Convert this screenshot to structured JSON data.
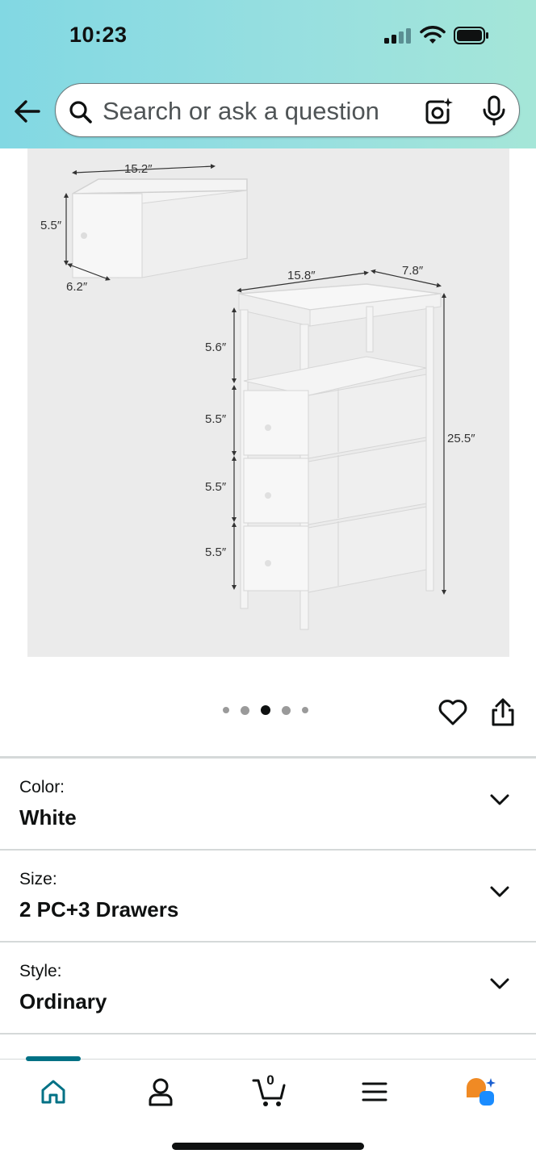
{
  "status_bar": {
    "time": "10:23"
  },
  "search": {
    "placeholder": "Search or ask a question"
  },
  "product_image": {
    "dimensions": {
      "drawer_width": "15.2″",
      "drawer_height": "5.5″",
      "drawer_depth": "6.2″",
      "unit_width": "15.8″",
      "unit_depth": "7.8″",
      "unit_height": "25.5″",
      "shelf_gap": "5.6″",
      "drawer1": "5.5″",
      "drawer2": "5.5″",
      "drawer3": "5.5″"
    },
    "carousel": {
      "total": 5,
      "active_index": 2
    }
  },
  "variants": [
    {
      "label": "Color:",
      "value": "White"
    },
    {
      "label": "Size:",
      "value": "2 PC+3 Drawers"
    },
    {
      "label": "Style:",
      "value": "Ordinary"
    }
  ],
  "cart": {
    "count": "0"
  },
  "icons": {
    "back": "back-arrow-icon",
    "search": "search-icon",
    "camera": "camera-lens-icon",
    "mic": "microphone-icon",
    "heart": "heart-icon",
    "share": "share-icon",
    "chevron": "chevron-down-icon",
    "home": "home-icon",
    "account": "account-icon",
    "cart": "cart-icon",
    "menu": "menu-icon",
    "rufus": "rufus-icon"
  },
  "colors": {
    "header_gradient_start": "#82d8e3",
    "header_gradient_end": "#a5e6d8",
    "accent": "#007185",
    "rufus_orange": "#f08a24",
    "rufus_blue": "#1a8cff"
  }
}
